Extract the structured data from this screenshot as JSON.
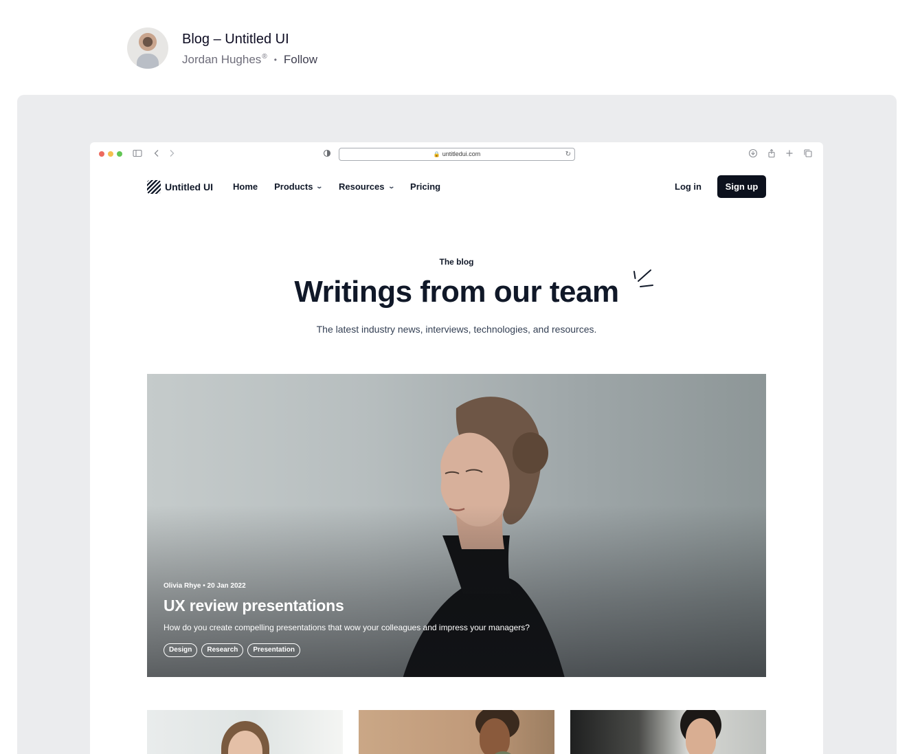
{
  "shot": {
    "title": "Blog – Untitled UI",
    "author": "Jordan Hughes",
    "author_mark": "®",
    "separator": "•",
    "follow_label": "Follow"
  },
  "browser": {
    "url": "untitledui.com"
  },
  "site": {
    "logo_text": "Untitled UI",
    "nav": {
      "home": "Home",
      "products": "Products",
      "resources": "Resources",
      "pricing": "Pricing"
    },
    "login_label": "Log in",
    "signup_label": "Sign up"
  },
  "hero": {
    "eyebrow": "The blog",
    "headline": "Writings from our team",
    "subhead": "The latest industry news, interviews, technologies, and resources."
  },
  "featured": {
    "meta": "Olivia Rhye • 20 Jan 2022",
    "title": "UX review presentations",
    "description": "How do you create compelling presentations that wow your colleagues and impress your managers?",
    "tags": [
      "Design",
      "Research",
      "Presentation"
    ]
  },
  "colors": {
    "accent": "#0c111d",
    "frame": "#ebecee"
  }
}
